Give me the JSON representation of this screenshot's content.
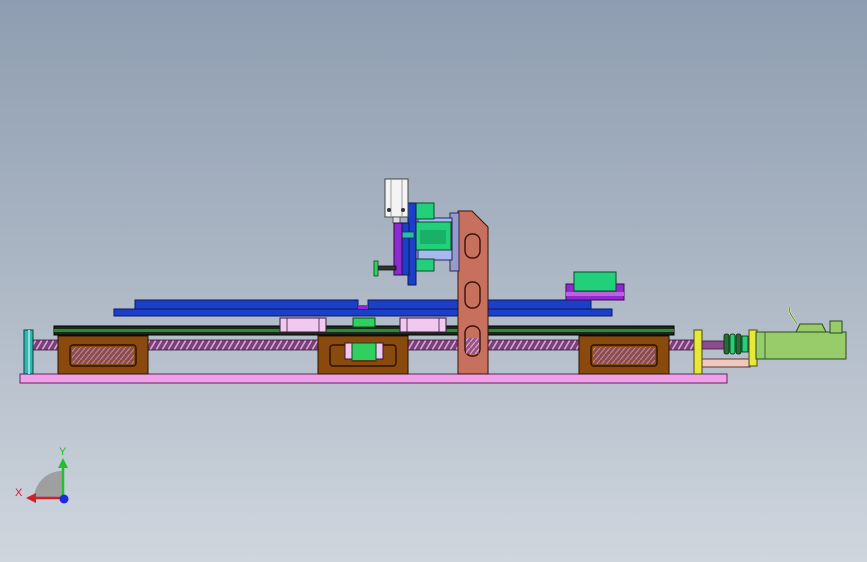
{
  "triad": {
    "x_label": "X",
    "y_label": "Y",
    "x_color": "#d0202a",
    "y_color": "#22c030",
    "z_color": "#1a2adf"
  },
  "colors": {
    "base_plate": "#f2a0ea",
    "frame_brown": "#8a4a0e",
    "column_red": "#c8705e",
    "rail_blue": "#1b3fc8",
    "rail_blue_dark": "#1530a8",
    "rail_black": "#1a2a1a",
    "screw_purple": "#8a4c8a",
    "slider_pink": "#f0c8f0",
    "green": "#22d07a",
    "motor_green": "#98cc6a",
    "yellow": "#e8e83a",
    "teal": "#30b8b0",
    "cylinder_white": "#f4f4f4",
    "violet": "#8e2ad0"
  }
}
